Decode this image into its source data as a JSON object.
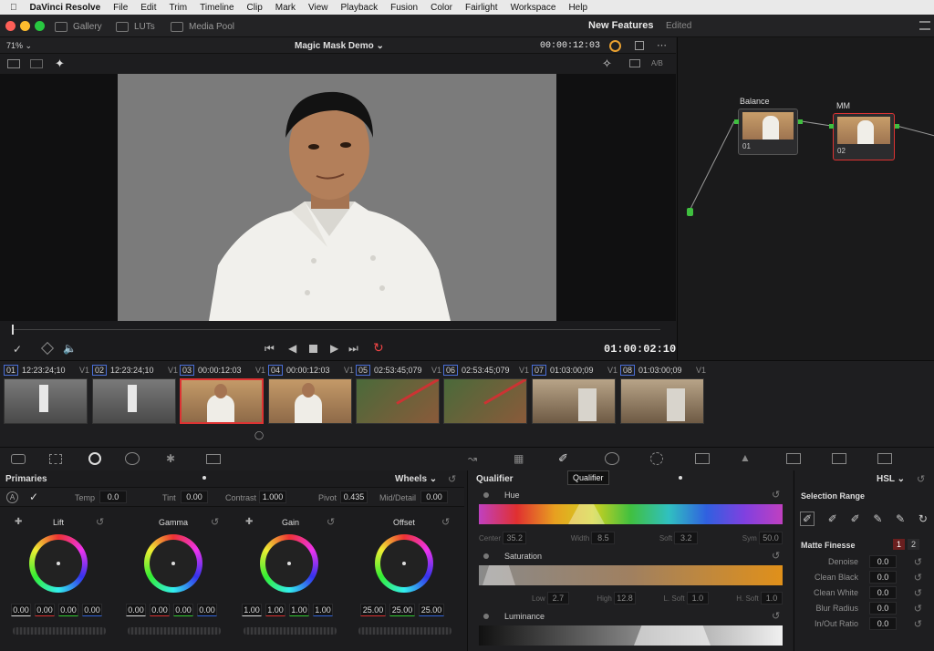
{
  "menubar": {
    "apple_icon": "apple-icon",
    "app_name": "DaVinci Resolve",
    "items": [
      "File",
      "Edit",
      "Trim",
      "Timeline",
      "Clip",
      "Mark",
      "View",
      "Playback",
      "Fusion",
      "Color",
      "Fairlight",
      "Workspace",
      "Help"
    ]
  },
  "titlebar": {
    "buttons": {
      "gallery": "Gallery",
      "luts": "LUTs",
      "media_pool": "Media Pool"
    },
    "project_title": "New Features",
    "status": "Edited"
  },
  "viewer": {
    "zoom": "71%",
    "clip_name": "Magic Mask Demo",
    "timecode": "00:00:12:03",
    "ab_label": "A/B",
    "playhead_timecode": "01:00:02:10"
  },
  "nodes": [
    {
      "label": "Balance",
      "number": "01"
    },
    {
      "label": "MM",
      "number": "02"
    }
  ],
  "clips": [
    {
      "num": "01",
      "tc": "12:23:24;10",
      "track": "V1",
      "scene": "road",
      "selected": false
    },
    {
      "num": "02",
      "tc": "12:23:24;10",
      "track": "V1",
      "scene": "road",
      "selected": false
    },
    {
      "num": "03",
      "tc": "00:00:12:03",
      "track": "V1",
      "scene": "chef",
      "selected": true
    },
    {
      "num": "04",
      "tc": "00:00:12:03",
      "track": "V1",
      "scene": "chef",
      "selected": false
    },
    {
      "num": "05",
      "tc": "02:53:45;079",
      "track": "V1",
      "scene": "bike",
      "selected": false
    },
    {
      "num": "06",
      "tc": "02:53:45;079",
      "track": "V1",
      "scene": "bike",
      "selected": false
    },
    {
      "num": "07",
      "tc": "01:03:00;09",
      "track": "V1",
      "scene": "oven",
      "selected": false
    },
    {
      "num": "08",
      "tc": "01:03:00;09",
      "track": "V1",
      "scene": "oven",
      "selected": false
    }
  ],
  "tooltip": "Qualifier",
  "primaries": {
    "title": "Primaries",
    "mode": "Wheels",
    "params": {
      "temp_label": "Temp",
      "temp": "0.0",
      "tint_label": "Tint",
      "tint": "0.00",
      "contrast_label": "Contrast",
      "contrast": "1.000",
      "pivot_label": "Pivot",
      "pivot": "0.435",
      "middetail_label": "Mid/Detail",
      "middetail": "0.00"
    },
    "wheels": [
      {
        "name": "Lift",
        "values": [
          "0.00",
          "0.00",
          "0.00",
          "0.00"
        ]
      },
      {
        "name": "Gamma",
        "values": [
          "0.00",
          "0.00",
          "0.00",
          "0.00"
        ]
      },
      {
        "name": "Gain",
        "values": [
          "1.00",
          "1.00",
          "1.00",
          "1.00"
        ]
      },
      {
        "name": "Offset",
        "values": [
          "25.00",
          "25.00",
          "25.00"
        ]
      }
    ]
  },
  "qualifier": {
    "title": "Qualifier",
    "mode": "HSL",
    "hue": {
      "label": "Hue",
      "center_label": "Center",
      "center": "35.2",
      "width_label": "Width",
      "width": "8.5",
      "soft_label": "Soft",
      "soft": "3.2",
      "sym_label": "Sym",
      "sym": "50.0"
    },
    "saturation": {
      "label": "Saturation",
      "low_label": "Low",
      "low": "2.7",
      "high_label": "High",
      "high": "12.8",
      "lsoft_label": "L. Soft",
      "lsoft": "1.0",
      "hsoft_label": "H. Soft",
      "hsoft": "1.0"
    },
    "luminance": {
      "label": "Luminance"
    }
  },
  "selection": {
    "title": "Selection Range",
    "matte_title": "Matte Finesse",
    "tabs": [
      "1",
      "2"
    ],
    "rows": [
      {
        "label": "Denoise",
        "value": "0.0"
      },
      {
        "label": "Clean Black",
        "value": "0.0"
      },
      {
        "label": "Clean White",
        "value": "0.0"
      },
      {
        "label": "Blur Radius",
        "value": "0.0"
      },
      {
        "label": "In/Out Ratio",
        "value": "0.0"
      }
    ]
  },
  "colors": {
    "accent_red": "#d33333",
    "clip_number_blue": "#4a6fd8",
    "tc_white": "#e8e8e8"
  }
}
